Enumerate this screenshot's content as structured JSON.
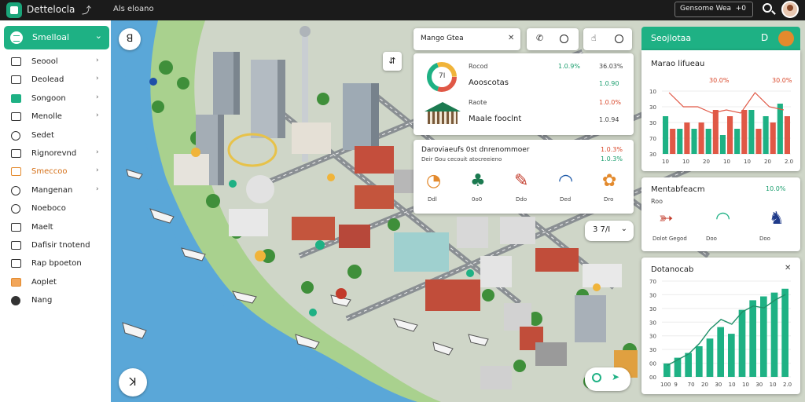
{
  "topbar": {
    "title": "Dettelocla",
    "tool_icon": "pin-tool-icon",
    "menu_label": "Als eloano",
    "search_text": "Gensome Wea",
    "search_count": "+0"
  },
  "sidebar": {
    "header": "Smelloal",
    "items": [
      {
        "label": "Seoool",
        "chevron": true
      },
      {
        "label": "Deolead",
        "chevron": true
      },
      {
        "label": "Songoon",
        "chevron": true
      },
      {
        "label": "Menolle",
        "chevron": true
      },
      {
        "label": "Sedet",
        "chevron": false
      },
      {
        "label": "Rignorevnd",
        "chevron": true
      },
      {
        "label": "Smeccoo",
        "chevron": true,
        "active": true
      },
      {
        "label": "Mangenan",
        "chevron": true
      },
      {
        "label": "Noeboco",
        "chevron": false
      },
      {
        "label": "Maelt",
        "chevron": false
      },
      {
        "label": "Dafisir tnotend",
        "chevron": false
      },
      {
        "label": "Rap bpoeton",
        "chevron": false
      },
      {
        "label": "Aoplet",
        "chevron": false
      },
      {
        "label": "Nang",
        "chevron": false
      }
    ]
  },
  "map": {
    "zoom_label": "3 7/I",
    "top_left_btn": "ꓭ",
    "bottom_left_btn": "ꓘ"
  },
  "panel_main": {
    "title": "Mango Gtea",
    "pill_left_icons": [
      "phone-icon",
      "clock-icon"
    ],
    "pill_right_icons": [
      "cursor-icon",
      "clock-icon"
    ],
    "donut_label": "7I",
    "rows": [
      {
        "label": "Rocod",
        "v1": "1.0.9%",
        "v2": "36.03%"
      },
      {
        "label": "Aooscotas",
        "v1": "",
        "v2": "1.0.90"
      },
      {
        "label": "Raote",
        "v1": "",
        "v2": "1.0.0%"
      },
      {
        "label": "Maale fooclnt",
        "v1": "",
        "v2": "1.0.94"
      }
    ]
  },
  "panel_mid": {
    "title": "Daroviaeufs 0st dnrenommoer",
    "subtitle": "Deir Gou cecouit atocreeieno",
    "v1": "1.0.3%",
    "v2": "1.0.3%",
    "icons": [
      {
        "name": "donut-chart-icon",
        "label": "Ddl"
      },
      {
        "name": "tree-icon",
        "label": "0o0"
      },
      {
        "name": "pencil-icon",
        "label": "Ddo"
      },
      {
        "name": "gauge-icon",
        "label": "Ded"
      },
      {
        "name": "flower-icon",
        "label": "Dro"
      }
    ]
  },
  "right_panel": {
    "header": "Seojlotaa",
    "header_btn": "D"
  },
  "chart1": {
    "title": "Marao lifueau",
    "legend_left": "30.0%",
    "legend_right": "30.0%"
  },
  "panel_mode": {
    "title": "Mentabfeacm",
    "sub": "Roo",
    "value": "10.0%",
    "icons": [
      {
        "name": "arrow-icon",
        "label": "Dolot Gegod"
      },
      {
        "name": "gauge-icon",
        "label": "Doo"
      },
      {
        "name": "boots-icon",
        "label": "Doo"
      }
    ]
  },
  "chart2": {
    "title": "Dotanocab"
  },
  "colors": {
    "accent": "#1eb184",
    "orange": "#e38a2d",
    "red": "#e05846",
    "water": "#5aa7d8"
  },
  "chart_data": [
    {
      "type": "bar",
      "title": "Marao lifueau",
      "ytick_labels": [
        "10",
        "30",
        "30",
        "70",
        "30"
      ],
      "xtick_labels": [
        "10",
        "10",
        "20",
        "10",
        "10",
        "20",
        "2.0"
      ],
      "series": [
        {
          "values": [
            60,
            40,
            40,
            40,
            30,
            40,
            70,
            60,
            80
          ]
        },
        {
          "values": [
            40,
            50,
            50,
            70,
            60,
            70,
            40,
            50,
            60
          ]
        }
      ],
      "colors": [
        "#1eb184",
        "#e05846"
      ]
    },
    {
      "type": "bar",
      "title": "Dotanocab",
      "ytick_labels": [
        "70",
        "30",
        "30",
        "30",
        "30",
        "30",
        "00",
        "00"
      ],
      "xtick_labels": [
        "100",
        "9",
        "70",
        "20",
        "30",
        "10",
        "10",
        "30",
        "10",
        "2.0"
      ],
      "values": [
        14,
        20,
        25,
        32,
        40,
        52,
        45,
        70,
        80,
        84,
        88,
        92
      ],
      "line": [
        12,
        18,
        24,
        35,
        50,
        60,
        55,
        68,
        74,
        72,
        80,
        86
      ]
    }
  ]
}
